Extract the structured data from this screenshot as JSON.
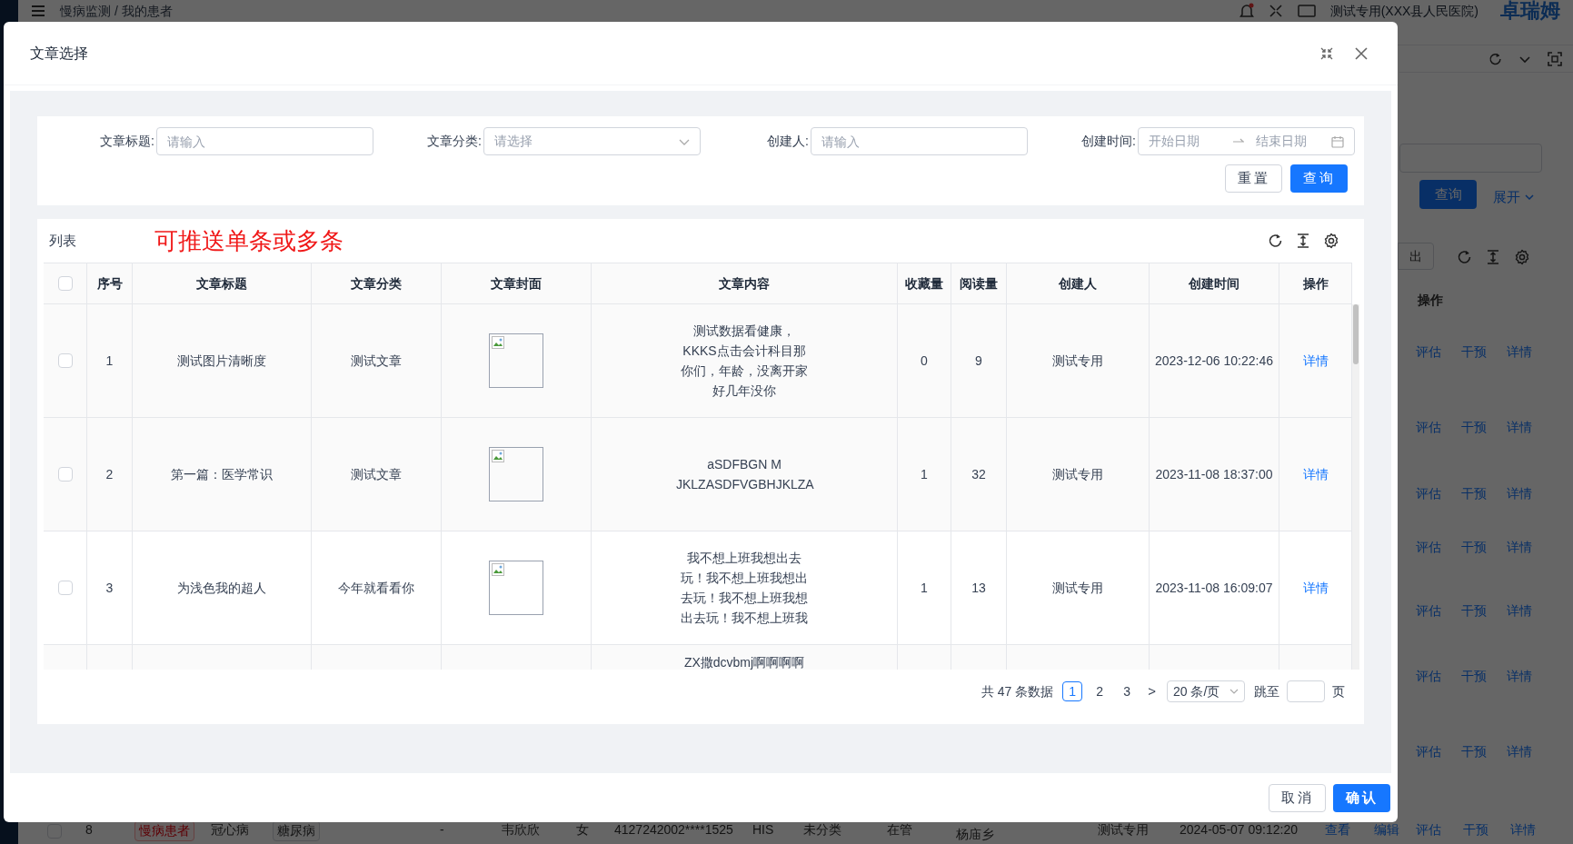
{
  "background": {
    "breadcrumb": "慢病监测 / 我的患者",
    "user": "测试专用(XXX县人民医院)",
    "logo": "卓瑞姆",
    "query_button": "查询",
    "expand_link": "展开",
    "export_button": "出",
    "action_header": "操作",
    "row_actions": [
      [
        "评估",
        "干预",
        "详情"
      ],
      [
        "评估",
        "干预",
        "详情"
      ],
      [
        "评估",
        "干预",
        "详情"
      ],
      [
        "评估",
        "干预",
        "详情"
      ],
      [
        "评估",
        "干预",
        "详情"
      ],
      [
        "评估",
        "干预",
        "详情"
      ],
      [
        "评估",
        "干预",
        "详情"
      ]
    ],
    "bottom_row": {
      "checked": false,
      "cells": [
        "8",
        "慢病患者",
        "冠心病",
        "糖尿病",
        "-",
        "韦欣欣",
        "女",
        "4127242002****1525",
        "HIS",
        "未分类",
        "在管",
        "杨庙乡",
        "测试专用",
        "2024-05-07 09:12:20"
      ],
      "actions": [
        "查看",
        "编辑",
        "评估",
        "干预",
        "详情"
      ]
    }
  },
  "dialog": {
    "title": "文章选择",
    "filters": [
      {
        "kind": "input",
        "label": "文章标题:",
        "placeholder": "请输入"
      },
      {
        "kind": "select",
        "label": "文章分类:",
        "placeholder": "请选择"
      },
      {
        "kind": "input",
        "label": "创建人:",
        "placeholder": "请输入"
      },
      {
        "kind": "daterange",
        "label": "创建时间:",
        "start_placeholder": "开始日期",
        "end_placeholder": "结束日期"
      }
    ],
    "reset_button": "重置",
    "query_button": "查询",
    "list_title": "列表",
    "annotation": "可推送单条或多条",
    "table": {
      "select_all_checked": false,
      "columns": [
        "序号",
        "文章标题",
        "文章分类",
        "文章封面",
        "文章内容",
        "收藏量",
        "阅读量",
        "创建人",
        "创建时间",
        "操作"
      ],
      "rows": [
        {
          "checked": false,
          "index": "1",
          "title": "测试图片清晰度",
          "category": "测试文章",
          "content": [
            "测试数据看健康，",
            "KKKS点击会计科目那",
            "你们，年龄，没离开家",
            "好几年没你"
          ],
          "favorites": "0",
          "reads": "9",
          "creator": "测试专用",
          "created": "2023-12-06 10:22:46",
          "action": "详情"
        },
        {
          "checked": false,
          "index": "2",
          "title": "第一篇：医学常识",
          "category": "测试文章",
          "content": [
            "aSDFBGN M",
            "JKLZASDFVGBHJKLZA"
          ],
          "favorites": "1",
          "reads": "32",
          "creator": "测试专用",
          "created": "2023-11-08 18:37:00",
          "action": "详情"
        },
        {
          "checked": false,
          "index": "3",
          "title": "为浅色我的超人",
          "category": "今年就看看你",
          "content": [
            "我不想上班我想出去",
            "玩！我不想上班我想出",
            "去玩！我不想上班我想",
            "出去玩！我不想上班我"
          ],
          "favorites": "1",
          "reads": "13",
          "creator": "测试专用",
          "created": "2023-11-08 16:09:07",
          "action": "详情"
        },
        {
          "content": [
            "ZX撒dcvbmj啊啊啊啊"
          ]
        }
      ]
    },
    "pagination": {
      "total": "共 47 条数据",
      "pages": [
        {
          "label": "1",
          "selected": true
        },
        {
          "label": "2",
          "selected": false
        },
        {
          "label": "3",
          "selected": false
        }
      ],
      "next": ">",
      "page_size": "20 条/页",
      "jump_label": "跳至",
      "page_unit": "页"
    },
    "cancel_button": "取消",
    "confirm_button": "确认"
  }
}
